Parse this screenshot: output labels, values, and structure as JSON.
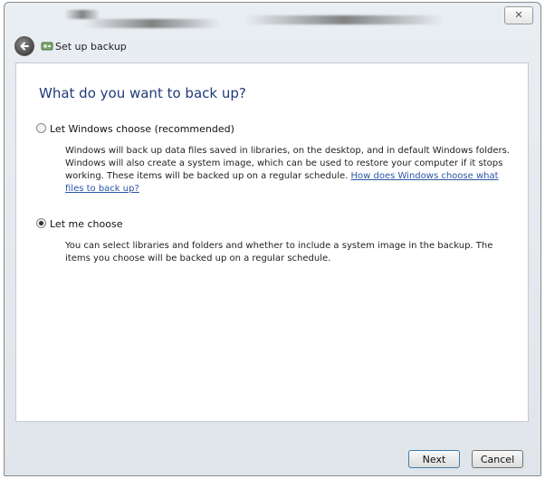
{
  "window": {
    "title": "Set up backup",
    "close_glyph": "✕"
  },
  "main": {
    "heading": "What do you want to back up?",
    "options": [
      {
        "label": "Let Windows choose (recommended)",
        "selected": false,
        "description": "Windows will back up data files saved in libraries, on the desktop, and in default Windows folders. Windows will also create a system image, which can be used to restore your computer if it stops working. These items will be backed up on a regular schedule.",
        "link": "How does Windows choose what files to back up?"
      },
      {
        "label": "Let me choose",
        "selected": true,
        "description": "You can select libraries and folders and whether to include a system image in the backup. The items you choose will be backed up on a regular schedule."
      }
    ]
  },
  "footer": {
    "next_label": "Next",
    "cancel_label": "Cancel"
  },
  "icons": [
    "back-arrow-icon",
    "backup-app-icon",
    "close-icon",
    "radio-unchecked-icon",
    "radio-checked-icon"
  ],
  "colors": {
    "heading": "#1f3b79",
    "link": "#2b56a6",
    "chrome": "#e3e8ed"
  }
}
